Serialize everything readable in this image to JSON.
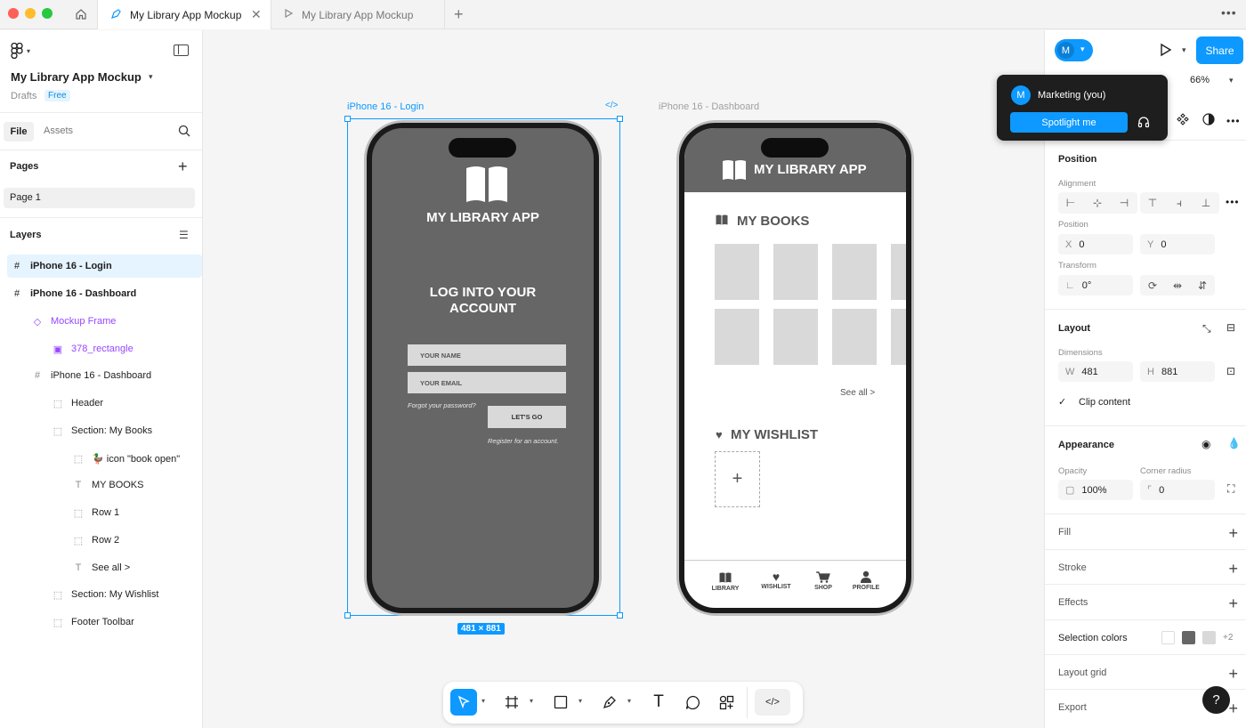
{
  "tabs": {
    "active": "My Library App Mockup",
    "inactive": "My Library App Mockup",
    "add": "+"
  },
  "file": {
    "name": "My Library App Mockup",
    "location": "Drafts",
    "plan": "Free"
  },
  "left_tabs": {
    "file": "File",
    "assets": "Assets"
  },
  "pages": {
    "title": "Pages",
    "items": [
      "Page 1"
    ]
  },
  "layers": {
    "title": "Layers",
    "items": [
      "iPhone 16 - Login",
      "iPhone 16 - Dashboard",
      "Mockup Frame",
      "378_rectangle",
      "iPhone 16 - Dashboard",
      "Header",
      "Section: My Books",
      "🦆 icon \"book open\"",
      "MY BOOKS",
      "Row 1",
      "Row 2",
      "See all >",
      "Section: My Wishlist",
      "Footer Toolbar"
    ]
  },
  "canvas": {
    "login_frame_label": "iPhone 16 - Login",
    "dashboard_frame_label": "iPhone 16 - Dashboard",
    "dimensions_badge": "481 × 881",
    "login": {
      "app_title": "MY LIBRARY APP",
      "heading_line1": "LOG INTO YOUR",
      "heading_line2": "ACCOUNT",
      "name_placeholder": "YOUR NAME",
      "email_placeholder": "YOUR EMAIL",
      "forgot": "Forgot your password?",
      "button": "LET'S GO",
      "register": "Register for an account."
    },
    "dashboard": {
      "app_title": "MY LIBRARY APP",
      "my_books": "MY BOOKS",
      "see_all": "See all >",
      "wishlist": "MY WISHLIST",
      "add": "+",
      "nav": [
        "LIBRARY",
        "WISHLIST",
        "SHOP",
        "PROFILE"
      ]
    }
  },
  "right": {
    "avatar_initial": "M",
    "share": "Share",
    "zoom": "66%",
    "popup": {
      "user": "Marketing (you)",
      "spotlight": "Spotlight me"
    },
    "position": {
      "title": "Position",
      "alignment": "Alignment",
      "position_label": "Position",
      "x_key": "X",
      "x": "0",
      "y_key": "Y",
      "y": "0",
      "transform": "Transform",
      "rotation": "0°"
    },
    "layout": {
      "title": "Layout",
      "dimensions": "Dimensions",
      "w_key": "W",
      "w": "481",
      "h_key": "H",
      "h": "881",
      "clip": "Clip content"
    },
    "appearance": {
      "title": "Appearance",
      "opacity_label": "Opacity",
      "opacity": "100%",
      "radius_label": "Corner radius",
      "radius": "0"
    },
    "fill": "Fill",
    "stroke": "Stroke",
    "effects": "Effects",
    "selection_colors": {
      "title": "Selection colors",
      "more": "+2",
      "swatches": [
        "#ffffff",
        "#666666",
        "#d9d9d9"
      ]
    },
    "layout_grid": "Layout grid",
    "export": "Export",
    "help": "?"
  },
  "colors": {
    "accent": "#0d99ff",
    "phone_screen": "#666666",
    "selection": "#0d99ff",
    "purple": "#9747ff"
  }
}
